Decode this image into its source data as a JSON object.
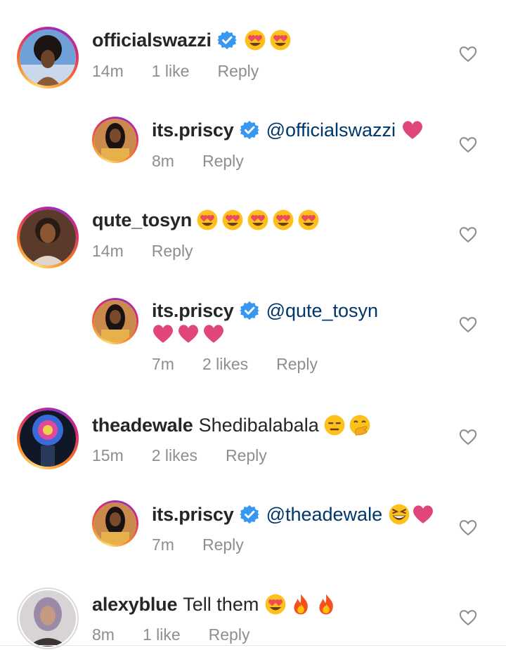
{
  "comments": [
    {
      "username": "officialswazzi",
      "text": "",
      "time": "14m",
      "likes": "1 like",
      "reply": "Reply",
      "verified": true,
      "emojis": [
        "smiling-heart-eyes",
        "smiling-heart-eyes"
      ]
    },
    {
      "username": "its.priscy",
      "mention": "@officialswazzi",
      "time": "8m",
      "reply": "Reply",
      "verified": true,
      "emojis": [
        "pink-heart"
      ]
    },
    {
      "username": "qute_tosyn",
      "text": "",
      "time": "14m",
      "reply": "Reply",
      "emojis": [
        "smiling-heart-eyes",
        "smiling-heart-eyes",
        "smiling-heart-eyes",
        "smiling-heart-eyes",
        "smiling-heart-eyes"
      ]
    },
    {
      "username": "its.priscy",
      "mention": "@qute_tosyn",
      "time": "7m",
      "likes": "2 likes",
      "reply": "Reply",
      "verified": true,
      "emojis": [
        "pink-heart",
        "pink-heart",
        "pink-heart"
      ]
    },
    {
      "username": "theadewale",
      "text": "Shedibalabala",
      "time": "15m",
      "likes": "2 likes",
      "reply": "Reply",
      "emojis": [
        "expressionless-face",
        "face-with-hand-over-mouth"
      ]
    },
    {
      "username": "its.priscy",
      "mention": "@theadewale",
      "time": "7m",
      "reply": "Reply",
      "verified": true,
      "emojis": [
        "grinning-squinting-face",
        "pink-heart"
      ]
    },
    {
      "username": "alexyblue",
      "text": "Tell them",
      "time": "8m",
      "likes": "1 like",
      "reply": "Reply",
      "emojis": [
        "smiling-heart-eyes",
        "fire",
        "fire"
      ]
    }
  ],
  "colors": {
    "verified_blue": "#3897f0",
    "mention_blue": "#00376b",
    "meta_gray": "#8e8e8e",
    "heart_pink": "#e0457b"
  }
}
